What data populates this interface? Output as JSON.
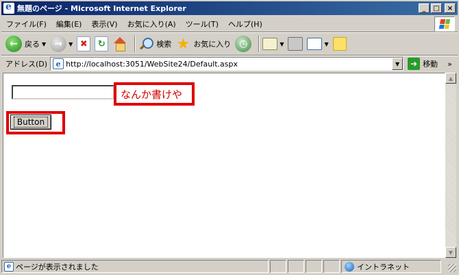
{
  "window": {
    "title": "無題のページ - Microsoft Internet Explorer",
    "controls": {
      "minimize": "_",
      "maximize": "□",
      "close": "×"
    }
  },
  "menu": {
    "items": [
      "ファイル(F)",
      "編集(E)",
      "表示(V)",
      "お気に入り(A)",
      "ツール(T)",
      "ヘルプ(H)"
    ]
  },
  "toolbar": {
    "back_label": "戻る",
    "search_label": "検索",
    "favorites_label": "お気に入り"
  },
  "address": {
    "label": "アドレス(D)",
    "url": "http://localhost:3051/WebSite24/Default.aspx",
    "go_label": "移動",
    "links_chevron": "»"
  },
  "page": {
    "text_input_value": "",
    "annotation": "なんか書けや",
    "button_label": "Button"
  },
  "status": {
    "text": "ページが表示されました",
    "zone": "イントラネット"
  },
  "icons": {
    "back": "back-arrow-icon",
    "forward": "forward-arrow-icon",
    "stop": "stop-icon",
    "refresh": "refresh-icon",
    "home": "home-icon",
    "search": "search-icon",
    "favorites": "star-icon",
    "history": "history-icon",
    "mail": "mail-icon",
    "print": "printer-icon",
    "edit": "edit-icon",
    "messenger": "note-icon"
  },
  "colors": {
    "titlebar_start": "#0a246a",
    "titlebar_end": "#3a6ea5",
    "annotation_red": "#e00000",
    "chrome": "#d4d0c8"
  }
}
